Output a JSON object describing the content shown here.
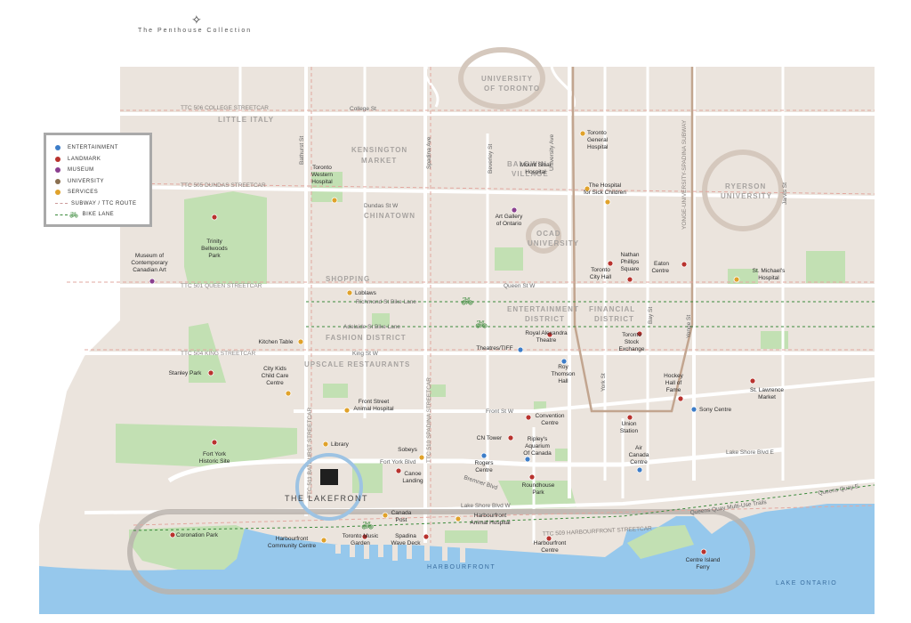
{
  "header": {
    "brand_mark": "✧",
    "brand_text": "The Penthouse Collection"
  },
  "legend": {
    "items": [
      {
        "label": "ENTERTAINMENT",
        "color": "#3d7dc8"
      },
      {
        "label": "LANDMARK",
        "color": "#b8332e"
      },
      {
        "label": "MUSEUM",
        "color": "#8a3f8f"
      },
      {
        "label": "UNIVERSITY",
        "color": "#8a6f50"
      },
      {
        "label": "SERVICES",
        "color": "#e0a22b"
      }
    ],
    "route_label": "SUBWAY / TTC ROUTE",
    "bike_label": "BIKE LANE"
  },
  "colors": {
    "land": "#ebe4dd",
    "park": "#c2e0b3",
    "water": "#96c8ec",
    "road": "#ffffff",
    "route": "#e2a8a0",
    "subway": "#c2a58f",
    "bike": "#3b8a3b",
    "entertainment": "#3d7dc8",
    "landmark": "#b8332e",
    "museum": "#8a3f8f",
    "university": "#8a6f50",
    "services": "#e0a22b"
  },
  "neighbourhoods": [
    {
      "label": "LITTLE ITALY"
    },
    {
      "label": "KENSINGTON"
    },
    {
      "label": "MARKET"
    },
    {
      "label": "CHINATOWN"
    },
    {
      "label": "BALDWIN"
    },
    {
      "label": "VILLAGE"
    },
    {
      "label": "SHOPPING"
    },
    {
      "label": "ENTERTAINMENT"
    },
    {
      "label": "DISTRICT"
    },
    {
      "label": "FINANCIAL"
    },
    {
      "label": "DISTRICT"
    },
    {
      "label": "FASHION DISTRICT"
    },
    {
      "label": "UPSCALE RESTAURANTS"
    },
    {
      "label": "HARBOURFRONT"
    },
    {
      "label": "LAKE ONTARIO"
    }
  ],
  "universities": [
    {
      "line1": "UNIVERSITY",
      "line2": "OF TORONTO"
    },
    {
      "line1": "RYERSON",
      "line2": "UNIVERSITY"
    },
    {
      "line1": "OCAD",
      "line2": "UNIVERSITY"
    }
  ],
  "routes": [
    {
      "label": "TTC 506 COLLEGE STREETCAR"
    },
    {
      "label": "TTC 505 DUNDAS STREETCAR"
    },
    {
      "label": "TTC 501 QUEEN STREETCAR"
    },
    {
      "label": "TTC 504 KING STREETCAR"
    },
    {
      "label": "TTC 510 SPADINA STREETCAR"
    },
    {
      "label": "TTC 511 BATHURST STREETCAR"
    },
    {
      "label": "TTC 509 HARBOURFRONT STREETCAR"
    },
    {
      "label": "YONGE-UNIVERSITY-SPADINA SUBWAY"
    }
  ],
  "streets": [
    {
      "label": "College St"
    },
    {
      "label": "Dundas St W"
    },
    {
      "label": "Queen St W"
    },
    {
      "label": "Richmond St Bike Lane"
    },
    {
      "label": "Adelaide St Bike Lane"
    },
    {
      "label": "King St W"
    },
    {
      "label": "Front St W"
    },
    {
      "label": "Fort York Blvd"
    },
    {
      "label": "Bremner Blvd"
    },
    {
      "label": "Lake Shore Blvd W"
    },
    {
      "label": "Lake Shore Blvd E"
    },
    {
      "label": "Queens Quay E"
    },
    {
      "label": "Queens Quay Multi-Use Trails"
    },
    {
      "label": "Bathurst St"
    },
    {
      "label": "Spadina Ave"
    },
    {
      "label": "Beverley St"
    },
    {
      "label": "University Ave"
    },
    {
      "label": "York St"
    },
    {
      "label": "Bay St"
    },
    {
      "label": "Yonge St"
    },
    {
      "label": "Jarvis St"
    }
  ],
  "places": [
    {
      "name": "Toronto General Hospital",
      "lines": [
        "Toronto",
        "General",
        "Hospital"
      ],
      "type": "services"
    },
    {
      "name": "Toronto Western Hospital",
      "lines": [
        "Toronto",
        "Western",
        "Hospital"
      ],
      "type": "services"
    },
    {
      "name": "Mount Sinai Hospital",
      "lines": [
        "Mount Sinai",
        "Hospital"
      ],
      "type": "services"
    },
    {
      "name": "The Hospital for Sick Children",
      "lines": [
        "The Hospital",
        "for Sick Children"
      ],
      "type": "services"
    },
    {
      "name": "Art Gallery of Ontario",
      "lines": [
        "Art Gallery",
        "of Ontario"
      ],
      "type": "museum"
    },
    {
      "name": "Trinity Bellwoods Park",
      "lines": [
        "Trinity",
        "Bellwoods",
        "Park"
      ],
      "type": "landmark"
    },
    {
      "name": "Museum of Contemporary Canadian Art",
      "lines": [
        "Museum of",
        "Contemporary",
        "Canadian Art"
      ],
      "type": "museum"
    },
    {
      "name": "Nathan Phillips Square",
      "lines": [
        "Nathan",
        "Phillips",
        "Square"
      ],
      "type": "landmark"
    },
    {
      "name": "Toronto City Hall",
      "lines": [
        "Toronto",
        "City Hall"
      ],
      "type": "landmark"
    },
    {
      "name": "Eaton Centre",
      "lines": [
        "Eaton",
        "Centre"
      ],
      "type": "landmark"
    },
    {
      "name": "St. Michael's Hospital",
      "lines": [
        "St. Michael's",
        "Hospital"
      ],
      "type": "services"
    },
    {
      "name": "Loblaws",
      "lines": [
        "Loblaws"
      ],
      "type": "services"
    },
    {
      "name": "Kitchen Table",
      "lines": [
        "Kitchen Table"
      ],
      "type": "services"
    },
    {
      "name": "Royal Alexandra Theatre",
      "lines": [
        "Royal Alexandra",
        "Theatre"
      ],
      "type": "landmark"
    },
    {
      "name": "Theatres/TIFF",
      "lines": [
        "Theatres/TIFF"
      ],
      "type": "entertainment"
    },
    {
      "name": "Roy Thomson Hall",
      "lines": [
        "Roy",
        "Thomson",
        "Hall"
      ],
      "type": "entertainment"
    },
    {
      "name": "Toronto Stock Exchange",
      "lines": [
        "Toronto",
        "Stock",
        "Exchange"
      ],
      "type": "landmark"
    },
    {
      "name": "Stanley Park",
      "lines": [
        "Stanley Park"
      ],
      "type": "landmark"
    },
    {
      "name": "City Kids Child Care Centre",
      "lines": [
        "City Kids",
        "Child Care",
        "Centre"
      ],
      "type": "services"
    },
    {
      "name": "Hockey Hall of Fame",
      "lines": [
        "Hockey",
        "Hall of",
        "Fame"
      ],
      "type": "landmark"
    },
    {
      "name": "St. Lawrence Market",
      "lines": [
        "St. Lawrence",
        "Market"
      ],
      "type": "landmark"
    },
    {
      "name": "Front Street Animal Hospital",
      "lines": [
        "Front Street",
        "Animal Hospital"
      ],
      "type": "services"
    },
    {
      "name": "Convention Centre",
      "lines": [
        "Convention",
        "Centre"
      ],
      "type": "landmark"
    },
    {
      "name": "Union Station",
      "lines": [
        "Union",
        "Station"
      ],
      "type": "landmark"
    },
    {
      "name": "Sony Centre",
      "lines": [
        "Sony Centre"
      ],
      "type": "entertainment"
    },
    {
      "name": "Fort York Historic Site",
      "lines": [
        "Fort York",
        "Historic Site"
      ],
      "type": "landmark"
    },
    {
      "name": "Library",
      "lines": [
        "Library"
      ],
      "type": "services"
    },
    {
      "name": "Sobeys",
      "lines": [
        "Sobeys"
      ],
      "type": "services"
    },
    {
      "name": "CN Tower",
      "lines": [
        "CN Tower"
      ],
      "type": "landmark"
    },
    {
      "name": "Ripley's Aquarium Of Canada",
      "lines": [
        "Ripley's",
        "Aquarium",
        "Of Canada"
      ],
      "type": "entertainment"
    },
    {
      "name": "Canoe Landing",
      "lines": [
        "Canoe",
        "Landing"
      ],
      "type": "landmark"
    },
    {
      "name": "Rogers Centre",
      "lines": [
        "Rogers",
        "Centre"
      ],
      "type": "entertainment"
    },
    {
      "name": "Air Canada Centre",
      "lines": [
        "Air",
        "Canada",
        "Centre"
      ],
      "type": "entertainment"
    },
    {
      "name": "Roundhouse Park",
      "lines": [
        "Roundhouse",
        "Park"
      ],
      "type": "landmark"
    },
    {
      "name": "Canada Post",
      "lines": [
        "Canada",
        "Post"
      ],
      "type": "services"
    },
    {
      "name": "Harbourfront Animal Hospital",
      "lines": [
        "Harbourfront",
        "Animal Hospital"
      ],
      "type": "services"
    },
    {
      "name": "Coronation Park",
      "lines": [
        "Coronation Park"
      ],
      "type": "landmark"
    },
    {
      "name": "Harbourfront Community Centre",
      "lines": [
        "Harbourfront",
        "Community Centre"
      ],
      "type": "services"
    },
    {
      "name": "Toronto Music Garden",
      "lines": [
        "Toronto Music",
        "Garden"
      ],
      "type": "landmark"
    },
    {
      "name": "Spadina Wave Deck",
      "lines": [
        "Spadina",
        "Wave Deck"
      ],
      "type": "landmark"
    },
    {
      "name": "Harbourfront Centre",
      "lines": [
        "Harbourfront",
        "Centre"
      ],
      "type": "landmark"
    },
    {
      "name": "Centre Island Ferry",
      "lines": [
        "Centre Island",
        "Ferry"
      ],
      "type": "landmark"
    }
  ],
  "property": {
    "name": "THE LAKEFRONT"
  }
}
